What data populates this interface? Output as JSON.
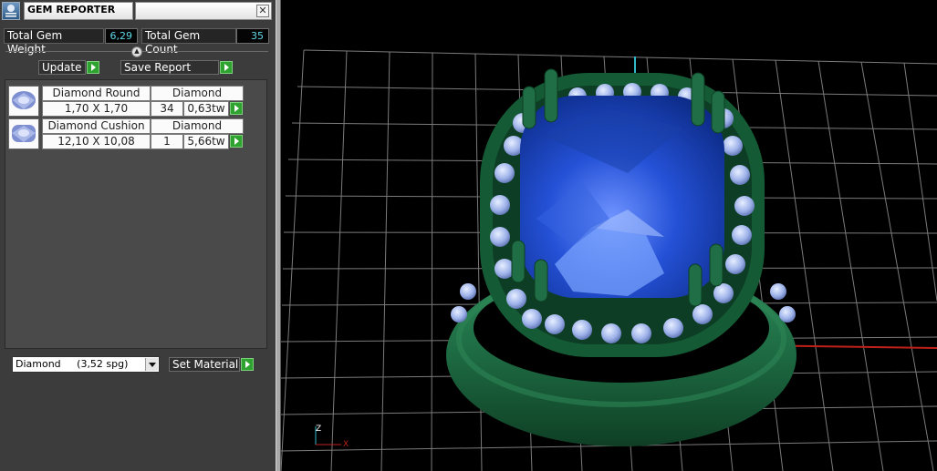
{
  "window": {
    "title": "GEM REPORTER",
    "close_symbol": "✕"
  },
  "summary": {
    "total_weight_label": "Total Gem Weight",
    "total_weight_value": "6,29",
    "total_count_label": "Total Gem Count",
    "total_count_value": "35"
  },
  "toolbar": {
    "update_label": "Update",
    "save_report_label": "Save Report",
    "collapse_symbol": "▲"
  },
  "gems": [
    {
      "name": "Diamond Round",
      "material": "Diamond",
      "size": "1,70 X 1,70",
      "count": "34",
      "weight": "0,63tw",
      "icon": "round-gem-icon"
    },
    {
      "name": "Diamond Cushion",
      "material": "Diamond",
      "size": "12,10 X 10,08",
      "count": "1",
      "weight": "5,66tw",
      "icon": "cushion-gem-icon"
    }
  ],
  "material": {
    "selected": "Diamond     (3,52 spg)",
    "set_label": "Set Material"
  },
  "axes": {
    "z": "Z",
    "x": "X"
  },
  "colors": {
    "accent_green": "#2fa32f",
    "value_cyan": "#5fd8e6",
    "gem_blue": "#1c46b8",
    "metal_green": "#1e6a42"
  }
}
